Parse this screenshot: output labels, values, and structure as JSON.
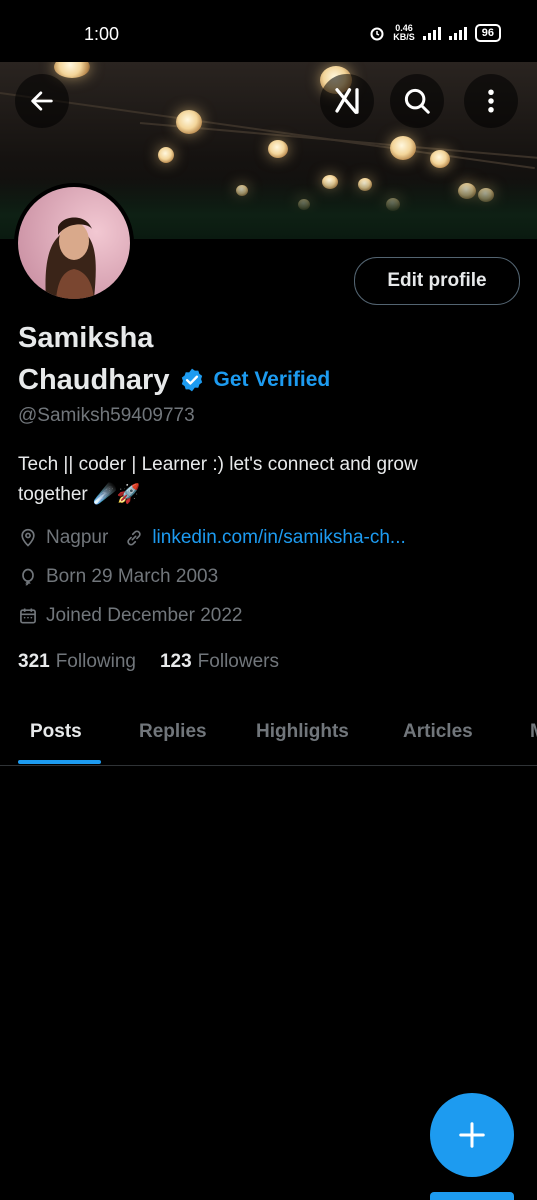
{
  "status_bar": {
    "time": "1:00",
    "net_speed": "0.46",
    "net_unit": "KB/S",
    "battery": "96"
  },
  "header": {
    "back_icon": "arrow-left-icon",
    "grok_icon": "grok-icon",
    "search_icon": "search-icon",
    "more_icon": "more-vertical-icon"
  },
  "profile": {
    "name_line1": "Samiksha",
    "name_line2": "Chaudhary",
    "get_verified": "Get Verified",
    "handle": "@Samiksh59409773",
    "bio_line1": "Tech ||  coder | Learner :)   let's connect and grow",
    "bio_line2": "together ☄️🚀",
    "location": "Nagpur",
    "website": "linkedin.com/in/samiksha-ch...",
    "born": "Born 29 March 2003",
    "joined": "Joined December 2022",
    "following_count": "321",
    "following_label": "Following",
    "followers_count": "123",
    "followers_label": "Followers",
    "edit_profile": "Edit profile"
  },
  "tabs": [
    {
      "label": "Posts",
      "active": true
    },
    {
      "label": "Replies",
      "active": false
    },
    {
      "label": "Highlights",
      "active": false
    },
    {
      "label": "Articles",
      "active": false
    }
  ],
  "colors": {
    "accent": "#1d9bf0",
    "background": "#000000",
    "text_primary": "#e7e9ea",
    "text_secondary": "#71767b"
  }
}
